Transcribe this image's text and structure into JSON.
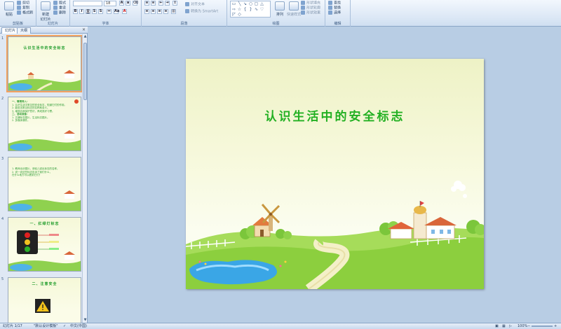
{
  "ribbon": {
    "clipboard": {
      "paste": "粘贴",
      "cut": "剪切",
      "copy": "复制",
      "format_painter": "格式刷",
      "label": "剪贴板"
    },
    "slides": {
      "new_slide": "新建\n幻灯片",
      "layout": "版式",
      "reset": "重设",
      "delete": "删除",
      "label": "幻灯片"
    },
    "font": {
      "font_size": "18",
      "label": "字体"
    },
    "paragraph": {
      "align_text": "对齐文本",
      "convert_smartart": "转换为 SmartArt",
      "label": "段落"
    },
    "drawing": {
      "arrange": "排列",
      "quick_styles": "快速样式",
      "shape_fill": "形状填充",
      "shape_outline": "形状轮廓",
      "shape_effects": "形状效果",
      "label": "绘图"
    },
    "editing": {
      "find": "查找",
      "replace": "替换",
      "select": "选择",
      "label": "编辑"
    }
  },
  "left_panel": {
    "tabs": [
      "幻灯片",
      "大纲"
    ],
    "close": "×",
    "thumbnails": [
      {
        "num": "1",
        "title": "认识生活中的安全标志",
        "lines": []
      },
      {
        "num": "2",
        "title": "",
        "lines": [
          "一、情境导入：",
          "1. 认识生活中常见的安全标志，知道它们的作用。",
          "2. 能说出常见标志的名称和含义。",
          "3. 增强自我保护意识，养成良好习惯。",
          "二、活动准备：",
          "1. 交通标志图片，生活标志图片。",
          "2. 多媒体课件。"
        ]
      },
      {
        "num": "3",
        "title": "",
        "lines": [
          "1. 教师出示图片，请幼儿说出标志的名称。",
          "2. 说一说这些标志告诉了我们什么，",
          "   在什么地方可以看到它们？"
        ]
      },
      {
        "num": "4",
        "title": "一、红绿灯标志",
        "lines": []
      },
      {
        "num": "5",
        "title": "二、注意安全",
        "lines": []
      }
    ]
  },
  "slide": {
    "title": "认识生活中的安全标志"
  },
  "status": {
    "slide_info": "幻灯片 1/17",
    "theme": "\"默认设计模板\"",
    "language": "中文(中国)",
    "zoom": "100%"
  },
  "colors": {
    "title_green": "#22b022",
    "ribbon_bg": "#dbe7f5",
    "canvas_bg": "#b8cde4"
  }
}
